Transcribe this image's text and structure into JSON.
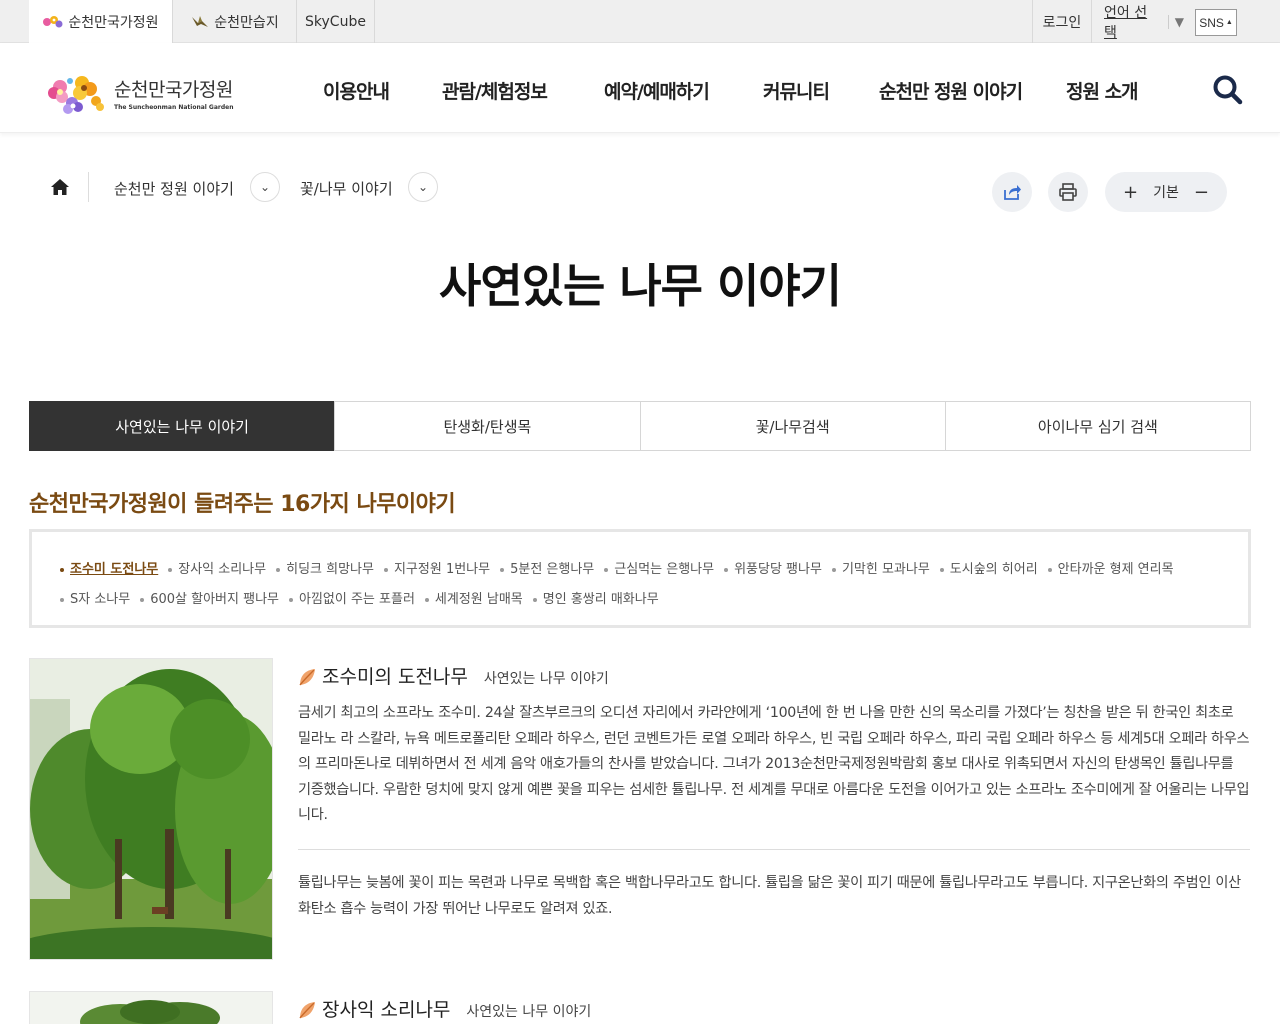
{
  "topbar": {
    "sites": [
      {
        "label": "순천만국가정원",
        "active": true
      },
      {
        "label": "순천만습지",
        "active": false
      },
      {
        "label": "SkyCube",
        "active": false
      }
    ],
    "login": "로그인",
    "language": "언어 선택",
    "sns": "SNS"
  },
  "header": {
    "logo_ko": "순천만국가정원",
    "logo_en": "The Suncheonman National Garden",
    "nav": [
      "이용안내",
      "관람/체험정보",
      "예약/예매하기",
      "커뮤니티",
      "순천만 정원 이야기",
      "정원 소개"
    ]
  },
  "breadcrumb": {
    "level1": "순천만 정원 이야기",
    "level2": "꽃/나무 이야기"
  },
  "fontsize": {
    "plus": "+",
    "label": "기본",
    "minus": "−"
  },
  "page_title": "사연있는 나무 이야기",
  "tabs": [
    {
      "label": "사연있는 나무 이야기",
      "active": true
    },
    {
      "label": "탄생화/탄생목",
      "active": false
    },
    {
      "label": "꽃/나무검색",
      "active": false
    },
    {
      "label": "아이나무 심기 검색",
      "active": false
    }
  ],
  "section_title": "순천만국가정원이 들려주는 16가지 나무이야기",
  "tree_list": [
    {
      "label": "조수미 도전나무",
      "active": true
    },
    {
      "label": "장사익 소리나무",
      "active": false
    },
    {
      "label": "히딩크 희망나무",
      "active": false
    },
    {
      "label": "지구정원 1번나무",
      "active": false
    },
    {
      "label": "5분전 은행나무",
      "active": false
    },
    {
      "label": "근심먹는 은행나무",
      "active": false
    },
    {
      "label": "위풍당당 팽나무",
      "active": false
    },
    {
      "label": "기막힌 모과나무",
      "active": false
    },
    {
      "label": "도시숲의 히어리",
      "active": false
    },
    {
      "label": "안타까운 형제 연리목",
      "active": false
    },
    {
      "label": "S자 소나무",
      "active": false
    },
    {
      "label": "600살 할아버지 팽나무",
      "active": false
    },
    {
      "label": "아낌없이 주는 포플러",
      "active": false
    },
    {
      "label": "세계정원 남매목",
      "active": false
    },
    {
      "label": "명인 홍쌍리 매화나무",
      "active": false
    }
  ],
  "stories": [
    {
      "name": "조수미의 도전나무",
      "category": "사연있는 나무 이야기",
      "body1": "금세기 최고의 소프라노 조수미. 24살 잘츠부르크의 오디션 자리에서 카라얀에게 ‘100년에 한 번 나올 만한 신의 목소리를 가졌다’는 칭찬을 받은 뒤 한국인 최초로 밀라노 라 스칼라, 뉴욕 메트로폴리탄 오페라 하우스, 런던 코벤트가든 로열 오페라 하우스, 빈 국립 오페라 하우스, 파리 국립 오페라 하우스 등 세계5대 오페라 하우스의 프리마돈나로 데뷔하면서 전 세계 음악 애호가들의 찬사를 받았습니다. 그녀가 2013순천만국제정원박람회 홍보 대사로 위촉되면서 자신의 탄생목인 튤립나무를 기증했습니다. 우람한 덩치에 맞지 않게 예쁜 꽃을 피우는 섬세한 튤립나무. 전 세계를 무대로 아름다운 도전을 이어가고 있는 소프라노 조수미에게 잘 어울리는 나무입니다.",
      "body2": "튤립나무는 늦봄에 꽃이 피는 목련과 나무로 목백합 혹은 백합나무라고도 합니다. 튤립을 닮은 꽃이 피기 때문에 튤립나무라고도 부릅니다. 지구온난화의 주범인 이산화탄소 흡수 능력이 가장 뛰어난 나무로도 알려져 있죠."
    },
    {
      "name": "장사익 소리나무",
      "category": "사연있는 나무 이야기"
    }
  ],
  "colors": {
    "accent_brown": "#7a4a12",
    "tab_active": "#333333",
    "search_icon": "#1b2a4a"
  },
  "icons": [
    "flower-logo-icon",
    "bird-icon",
    "home-icon",
    "chevron-down-icon",
    "share-icon",
    "print-icon",
    "search-icon",
    "leaf-icon"
  ]
}
